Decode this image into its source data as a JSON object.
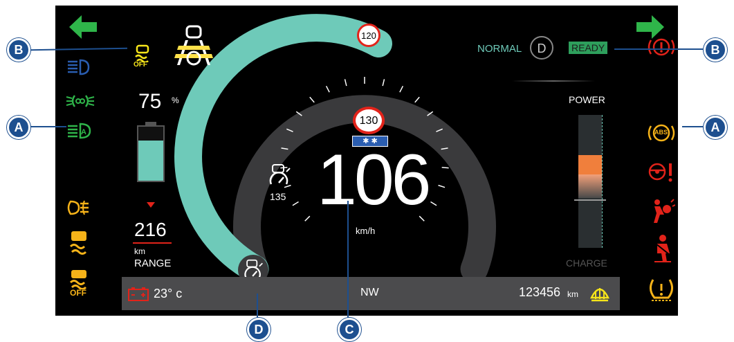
{
  "callouts": {
    "left_b": "B",
    "left_a": "A",
    "right_b": "B",
    "right_a": "A",
    "bottom_d": "D",
    "bottom_c": "C"
  },
  "speed": {
    "value": "106",
    "unit": "km/h",
    "limit_sign": "120",
    "road_sign": "130",
    "road_sign_sub": "✱ ✱",
    "cruise_value": "135"
  },
  "battery": {
    "percent": "75",
    "percent_unit": "%",
    "level": 0.75,
    "range_value": "216",
    "range_unit": "km",
    "range_label": "RANGE"
  },
  "drive": {
    "mode": "NORMAL",
    "gear": "D",
    "status": "READY"
  },
  "power": {
    "label_top": "POWER",
    "label_bottom": "CHARGE"
  },
  "bottom_bar": {
    "temperature": "23° c",
    "heading": "NW",
    "odometer": "123456",
    "odometer_unit": "km"
  },
  "left_icons": {
    "traction_off_label": "OFF",
    "stability_off_label": "OFF"
  },
  "right_icons": {
    "abs_label": "ABS"
  },
  "colors": {
    "background": "#000000",
    "arc_active": "#6ecab9",
    "arc_track": "#3a3a3c",
    "green": "#2fb54a",
    "amber": "#f6b319",
    "red": "#e2231a",
    "blue": "#2a5db0",
    "callout": "#1d4f8f",
    "power_orange": "#f07f3c"
  }
}
